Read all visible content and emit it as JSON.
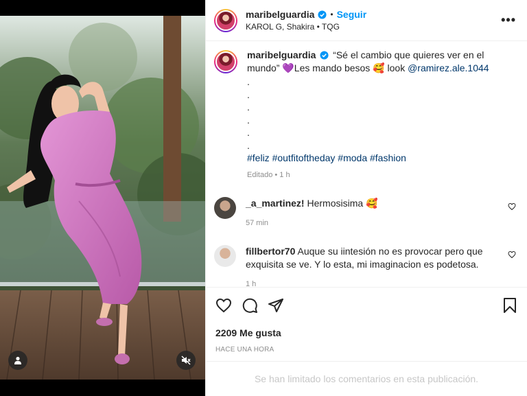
{
  "post": {
    "username": "maribelguardia",
    "follow_label": "Seguir",
    "separator": "•",
    "subtitle": "KAROL G, Shakira • TQG",
    "more_label": "•••"
  },
  "caption": {
    "username": "maribelguardia",
    "text": "“Sé el cambio que quieres ver en el mundo” 💜Les mando besos 🥰 look ",
    "mention": "@ramirez.ale.1044",
    "dots": ".\n.\n.\n.\n.\n.",
    "hashtags": "#feliz #outfitoftheday #moda #fashion",
    "meta": "Editado • 1 h"
  },
  "comments": [
    {
      "username": "_a_martinez!",
      "text": " Hermosisima 🥰",
      "time": "57 min"
    },
    {
      "username": "fillbertor70",
      "text": " Auque su iintesión no es provocar pero que exquisita se ve. Y lo esta, mi imaginacion es podetosa.",
      "time": "1 h"
    }
  ],
  "actions": {
    "likes_count": "2209",
    "likes_label": "Me gusta",
    "posted_when": "HACE UNA HORA",
    "comments_limited": "Se han limitado los comentarios en esta publicación."
  },
  "icons": {
    "verified": "verified-badge-icon",
    "like": "heart-icon",
    "comment": "comment-icon",
    "share": "share-icon",
    "save": "bookmark-icon",
    "more": "more-options-icon",
    "user": "user-tag-icon",
    "mute": "muted-audio-icon"
  },
  "colors": {
    "accent": "#0095f6",
    "link": "#00376b",
    "muted": "#8e8e8e",
    "dress": "#d17ac4"
  }
}
